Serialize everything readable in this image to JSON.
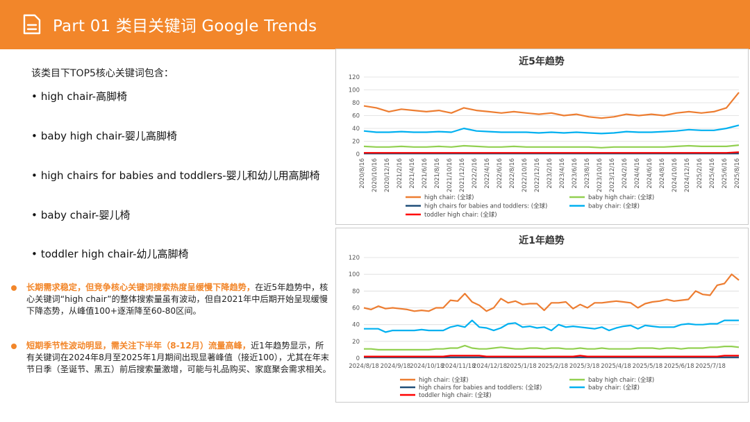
{
  "header": {
    "title": "Part 01 类目关键词 Google Trends",
    "icon": "document-icon",
    "color": "#f2862a"
  },
  "left": {
    "intro": "该类目下TOP5核心关键词包含：",
    "keywords": [
      "high chair-高脚椅",
      "baby high chair-婴儿高脚椅",
      "high chairs for babies and toddlers-婴儿和幼儿用高脚椅",
      "baby chair-婴儿椅",
      "toddler high chair-幼儿高脚椅"
    ],
    "notes": [
      {
        "highlight": "长期需求稳定，但竞争核心关键词搜索热度呈缓慢下降趋势，",
        "text": "在近5年趋势中，核心关键词“high chair”的整体搜索量虽有波动，但自2021年中后期开始呈现缓慢下降态势，从峰值100+逐渐降至60-80区间。"
      },
      {
        "highlight": "短期季节性波动明显，需关注下半年（8-12月）流量高峰，",
        "text": "近1年趋势显示，所有关键词在2024年8月至2025年1月期间出现显著峰值（接近100），尤其在年末节日季（圣诞节、黑五）前后搜索量激增，可能与礼品购买、家庭聚会需求相关。"
      }
    ]
  },
  "chart_data": [
    {
      "type": "line",
      "title": "近5年趋势",
      "ylim": [
        0,
        120
      ],
      "yticks": [
        0,
        20,
        40,
        60,
        80,
        100,
        120
      ],
      "grid": true,
      "legend_position": "bottom",
      "x_labels": [
        "2020/8/16",
        "2020/10/16",
        "2020/12/16",
        "2021/2/16",
        "2021/4/16",
        "2021/6/16",
        "2021/8/16",
        "2021/10/16",
        "2021/12/16",
        "2022/2/16",
        "2022/4/16",
        "2022/6/16",
        "2022/8/16",
        "2022/10/16",
        "2022/12/16",
        "2023/2/16",
        "2023/4/16",
        "2023/6/16",
        "2023/8/16",
        "2023/10/16",
        "2023/12/16",
        "2024/2/16",
        "2024/4/16",
        "2024/6/16",
        "2024/8/16",
        "2024/10/16",
        "2024/12/16",
        "2025/2/16",
        "2025/4/16",
        "2025/6/16",
        "2025/8/16"
      ],
      "series": [
        {
          "name": "high chair: (全球)",
          "color": "#ed7d31",
          "values": [
            75,
            72,
            66,
            70,
            68,
            66,
            68,
            64,
            72,
            68,
            66,
            64,
            66,
            64,
            62,
            64,
            60,
            62,
            58,
            56,
            58,
            62,
            60,
            62,
            60,
            64,
            66,
            64,
            66,
            72,
            96
          ]
        },
        {
          "name": "baby high chair: (全球)",
          "color": "#92d050",
          "values": [
            12,
            11,
            11,
            12,
            11,
            11,
            12,
            11,
            13,
            12,
            11,
            11,
            12,
            11,
            11,
            11,
            11,
            11,
            11,
            10,
            11,
            11,
            11,
            11,
            11,
            12,
            13,
            12,
            12,
            12,
            14
          ]
        },
        {
          "name": "high chairs for babies and toddlers: (全球)",
          "color": "#1f4e79",
          "values": [
            1,
            1,
            1,
            1,
            1,
            1,
            1,
            1,
            1,
            1,
            1,
            1,
            1,
            1,
            1,
            1,
            1,
            1,
            1,
            1,
            1,
            1,
            1,
            1,
            1,
            1,
            1,
            1,
            1,
            1,
            1
          ]
        },
        {
          "name": "baby chair: (全球)",
          "color": "#00b0f0",
          "values": [
            36,
            34,
            34,
            35,
            34,
            34,
            35,
            34,
            40,
            36,
            35,
            34,
            34,
            34,
            33,
            34,
            33,
            34,
            33,
            32,
            33,
            35,
            34,
            34,
            35,
            36,
            38,
            37,
            37,
            40,
            45
          ]
        },
        {
          "name": "toddler high chair: (全球)",
          "color": "#ff0000",
          "values": [
            2,
            2,
            2,
            2,
            2,
            2,
            2,
            2,
            2,
            2,
            2,
            2,
            2,
            2,
            2,
            2,
            2,
            2,
            2,
            2,
            2,
            2,
            2,
            2,
            2,
            2,
            2,
            2,
            2,
            2,
            3
          ]
        }
      ]
    },
    {
      "type": "line",
      "title": "近1年趋势",
      "ylim": [
        0,
        120
      ],
      "yticks": [
        0,
        20,
        40,
        60,
        80,
        100,
        120
      ],
      "grid": true,
      "legend_position": "bottom",
      "x_labels": [
        "2024/8/18",
        "2024/9/18",
        "2024/10/18",
        "2024/11/18",
        "2024/12/18",
        "2025/1/18",
        "2025/2/18",
        "2025/3/18",
        "2025/4/18",
        "2025/5/18",
        "2025/6/18",
        "2025/7/18"
      ],
      "series": [
        {
          "name": "high chair: (全球)",
          "color": "#ed7d31",
          "values": [
            60,
            58,
            62,
            59,
            60,
            59,
            58,
            56,
            57,
            56,
            60,
            60,
            69,
            68,
            77,
            67,
            63,
            56,
            60,
            71,
            66,
            68,
            64,
            65,
            65,
            57,
            66,
            66,
            67,
            59,
            64,
            60,
            66,
            66,
            67,
            68,
            67,
            66,
            60,
            65,
            67,
            68,
            70,
            68,
            69,
            70,
            80,
            76,
            75,
            87,
            89,
            100,
            93
          ]
        },
        {
          "name": "baby high chair: (全球)",
          "color": "#92d050",
          "values": [
            11,
            11,
            10,
            10,
            10,
            10,
            10,
            10,
            10,
            10,
            11,
            11,
            12,
            12,
            15,
            12,
            11,
            11,
            12,
            13,
            12,
            11,
            11,
            12,
            12,
            11,
            12,
            12,
            11,
            11,
            12,
            11,
            11,
            12,
            11,
            11,
            11,
            11,
            12,
            12,
            12,
            11,
            12,
            12,
            11,
            12,
            12,
            12,
            13,
            13,
            14,
            14,
            13
          ]
        },
        {
          "name": "high chairs for babies and toddlers: (全球)",
          "color": "#1f4e79",
          "values": [
            1,
            1,
            1,
            1,
            1,
            1,
            1,
            1,
            1,
            1,
            1,
            1,
            1,
            1,
            1,
            1,
            1,
            1,
            1,
            1,
            1,
            1,
            1,
            1,
            1,
            1,
            1,
            1,
            1,
            1,
            1,
            1,
            1,
            1,
            1,
            1,
            1,
            1,
            1,
            1,
            1,
            1,
            1,
            1,
            1,
            1,
            1,
            1,
            1,
            1,
            1,
            1,
            1
          ]
        },
        {
          "name": "baby chair: (全球)",
          "color": "#00b0f0",
          "values": [
            35,
            35,
            35,
            31,
            33,
            33,
            33,
            33,
            34,
            33,
            33,
            33,
            37,
            39,
            37,
            45,
            37,
            36,
            33,
            36,
            41,
            42,
            37,
            38,
            36,
            37,
            33,
            40,
            37,
            38,
            37,
            36,
            35,
            37,
            33,
            36,
            38,
            39,
            35,
            39,
            38,
            37,
            37,
            37,
            40,
            41,
            40,
            40,
            41,
            41,
            45,
            45,
            45
          ]
        },
        {
          "name": "toddler high chair: (全球)",
          "color": "#ff0000",
          "values": [
            2,
            2,
            2,
            2,
            2,
            2,
            2,
            2,
            2,
            2,
            2,
            2,
            3,
            3,
            3,
            3,
            3,
            2,
            2,
            2,
            2,
            2,
            2,
            2,
            2,
            2,
            2,
            2,
            2,
            2,
            3,
            2,
            2,
            2,
            2,
            2,
            2,
            2,
            2,
            2,
            2,
            2,
            2,
            2,
            2,
            2,
            2,
            2,
            2,
            2,
            3,
            3,
            3
          ]
        }
      ]
    }
  ]
}
